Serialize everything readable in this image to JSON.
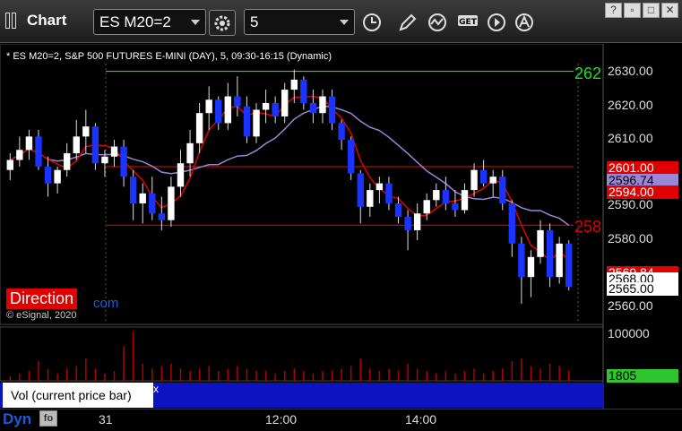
{
  "window": {
    "title": "Chart",
    "symbol": "ES M20=2",
    "interval": "5",
    "buttons": {
      "minimize": "?",
      "restore": "▫",
      "maximize": "□",
      "close": "✕"
    }
  },
  "toolbar": {
    "icons": [
      "gear-icon",
      "clock-icon",
      "pencil-icon",
      "study-icon",
      "get-icon",
      "play-icon",
      "alert-icon"
    ],
    "get_label": "GET"
  },
  "chart_header": "* ES M20=2, S&P 500 FUTURES E-MINI (DAY), 5, 09:30-16:15 (Dynamic)",
  "price_axis": [
    "2630.00",
    "2620.00",
    "2610.00",
    "2600.00",
    "2590.00",
    "2580.00",
    "2570.00",
    "2560.00"
  ],
  "price_tags": [
    {
      "label": "2601.00",
      "color": "#e00000",
      "text_color": "#ffffff"
    },
    {
      "label": "2596.74",
      "color": "#9a86d6",
      "text_color": "#000000"
    },
    {
      "label": "2594.00",
      "color": "#e00000",
      "text_color": "#ffffff"
    },
    {
      "label": "2569.84",
      "color": "#e00000",
      "text_color": "#ffffff"
    },
    {
      "label": "2568.00",
      "color": "#ffffff",
      "text_color": "#000000"
    },
    {
      "label": "2565.00",
      "color": "#ffffff",
      "text_color": "#000000"
    }
  ],
  "level_labels": {
    "green_line": "262",
    "red_line": "258"
  },
  "direction_label": "Direction",
  "com_label": "com",
  "copyright": "© eSignal, 2020",
  "volume": {
    "label": "Vol (current price bar)",
    "close": "x",
    "axis_label": "100000",
    "current_tag": "1805"
  },
  "bottom": {
    "dyn_label": "Dyn",
    "dyn_button": "fo",
    "x_labels": [
      "31",
      "12:00",
      "14:00"
    ]
  },
  "colors": {
    "up_candle": "#ffffff",
    "down_candle": "#1a33ff",
    "green_line": "#22dd22",
    "red_line": "#e00000",
    "purple_line": "#9a86d6",
    "volume_bar": "#b00000"
  },
  "chart_data": {
    "type": "candlestick",
    "y_axis": {
      "min": 2556,
      "max": 2635,
      "ticks": [
        2630,
        2620,
        2610,
        2600,
        2590,
        2580,
        2570,
        2560
      ]
    },
    "levels": [
      {
        "value": 2629.5,
        "color": "#22dd22"
      },
      {
        "value": 2601,
        "color": "#e00000"
      },
      {
        "value": 2583.5,
        "color": "#e00000"
      }
    ],
    "candles": [
      [
        2600,
        2605,
        2597,
        2603
      ],
      [
        2603,
        2610,
        2601,
        2606
      ],
      [
        2606,
        2612,
        2603,
        2610
      ],
      [
        2610,
        2612,
        2600,
        2601
      ],
      [
        2601,
        2604,
        2592,
        2596
      ],
      [
        2596,
        2601,
        2593,
        2600
      ],
      [
        2600,
        2608,
        2598,
        2605
      ],
      [
        2605,
        2615,
        2603,
        2610
      ],
      [
        2610,
        2618,
        2605,
        2613
      ],
      [
        2613,
        2614,
        2600,
        2602
      ],
      [
        2602,
        2606,
        2598,
        2604
      ],
      [
        2604,
        2609,
        2601,
        2607
      ],
      [
        2607,
        2609,
        2595,
        2598
      ],
      [
        2598,
        2600,
        2585,
        2590
      ],
      [
        2590,
        2596,
        2584,
        2593
      ],
      [
        2593,
        2598,
        2585,
        2587
      ],
      [
        2587,
        2592,
        2582,
        2585
      ],
      [
        2585,
        2598,
        2583,
        2595
      ],
      [
        2595,
        2606,
        2592,
        2602
      ],
      [
        2602,
        2612,
        2598,
        2608
      ],
      [
        2608,
        2620,
        2605,
        2617
      ],
      [
        2617,
        2625,
        2612,
        2621
      ],
      [
        2621,
        2622,
        2612,
        2614
      ],
      [
        2614,
        2626,
        2612,
        2622
      ],
      [
        2622,
        2628,
        2616,
        2619
      ],
      [
        2619,
        2622,
        2608,
        2610
      ],
      [
        2610,
        2620,
        2608,
        2618
      ],
      [
        2618,
        2624,
        2614,
        2620
      ],
      [
        2620,
        2622,
        2614,
        2616
      ],
      [
        2616,
        2626,
        2614,
        2624
      ],
      [
        2624,
        2630,
        2620,
        2627
      ],
      [
        2627,
        2628,
        2618,
        2620
      ],
      [
        2620,
        2624,
        2614,
        2617
      ],
      [
        2617,
        2624,
        2614,
        2622
      ],
      [
        2622,
        2624,
        2612,
        2614
      ],
      [
        2614,
        2615,
        2606,
        2609
      ],
      [
        2609,
        2610,
        2597,
        2599
      ],
      [
        2599,
        2600,
        2584,
        2589
      ],
      [
        2589,
        2596,
        2586,
        2594
      ],
      [
        2594,
        2598,
        2590,
        2596
      ],
      [
        2596,
        2598,
        2588,
        2590
      ],
      [
        2590,
        2592,
        2584,
        2586
      ],
      [
        2586,
        2588,
        2576,
        2582
      ],
      [
        2582,
        2590,
        2579,
        2587
      ],
      [
        2587,
        2593,
        2585,
        2591
      ],
      [
        2591,
        2596,
        2589,
        2594
      ],
      [
        2594,
        2598,
        2588,
        2590
      ],
      [
        2590,
        2594,
        2586,
        2588
      ],
      [
        2588,
        2596,
        2587,
        2594
      ],
      [
        2594,
        2602,
        2592,
        2600
      ],
      [
        2600,
        2603,
        2595,
        2596
      ],
      [
        2596,
        2600,
        2592,
        2598
      ],
      [
        2598,
        2600,
        2588,
        2590
      ],
      [
        2590,
        2591,
        2574,
        2578
      ],
      [
        2578,
        2580,
        2560,
        2568
      ],
      [
        2568,
        2576,
        2562,
        2574
      ],
      [
        2574,
        2585,
        2572,
        2582
      ],
      [
        2582,
        2584,
        2565,
        2568
      ],
      [
        2568,
        2580,
        2566,
        2578
      ],
      [
        2578,
        2579,
        2564,
        2565
      ]
    ],
    "volume": [
      2,
      3,
      4,
      8,
      5,
      3,
      5,
      6,
      9,
      5,
      3,
      4,
      14,
      20,
      7,
      5,
      6,
      7,
      5,
      4,
      5,
      6,
      4,
      5,
      6,
      5,
      4,
      4,
      3,
      4,
      5,
      4,
      3,
      4,
      4,
      5,
      6,
      9,
      5,
      4,
      5,
      4,
      7,
      5,
      4,
      3,
      4,
      3,
      4,
      5,
      3,
      4,
      5,
      8,
      9,
      6,
      5,
      7,
      6,
      4
    ]
  }
}
